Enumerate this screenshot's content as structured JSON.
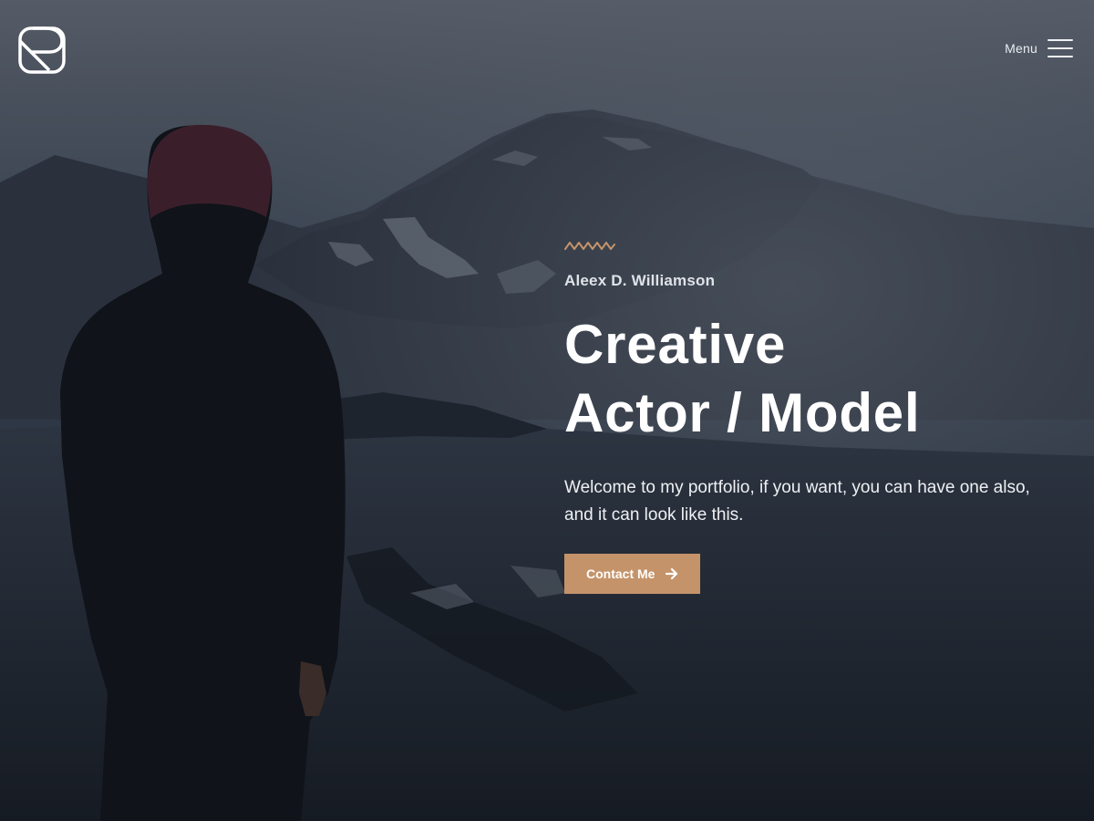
{
  "header": {
    "logo_icon": "rounded-square-r-logo-icon",
    "menu_label": "Menu",
    "menu_icon": "hamburger-icon"
  },
  "hero": {
    "ornament_icon": "zigzag-wave-icon",
    "name": "Aleex D. Williamson",
    "headline_line1": "Creative",
    "headline_line2": "Actor / Model",
    "intro": "Welcome to my portfolio, if you want, you can have one also, and it can look like this.",
    "cta_label": "Contact Me",
    "cta_icon": "arrow-right-icon"
  },
  "colors": {
    "accent": "#c5936a",
    "text": "#ffffff",
    "overlay": "#2a323f"
  }
}
